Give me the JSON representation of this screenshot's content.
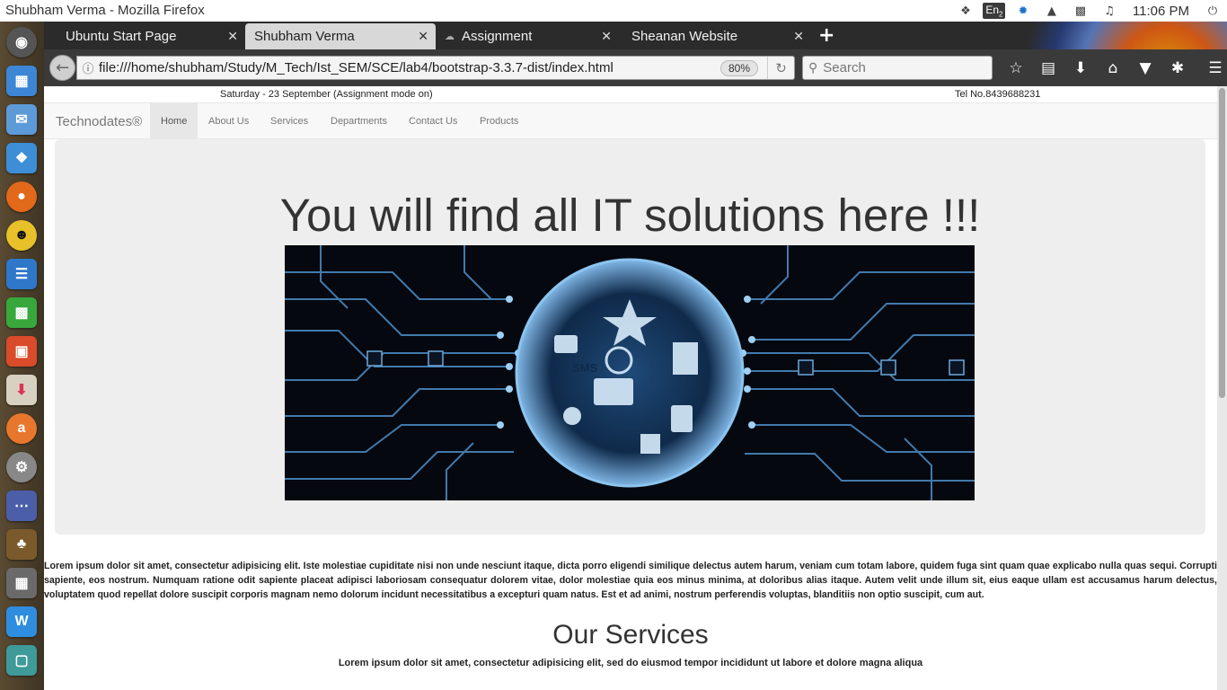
{
  "window": {
    "title": "Shubham Verma - Mozilla Firefox"
  },
  "tray": {
    "lang": "En",
    "lang_sub": "2",
    "clock": "11:06 PM"
  },
  "tabs": [
    {
      "label": "Ubuntu Start Page"
    },
    {
      "label": "Shubham Verma"
    },
    {
      "label": "Assignment"
    },
    {
      "label": "Sheanan Website"
    }
  ],
  "toolbar": {
    "url": "file:///home/shubham/Study/M_Tech/Ist_SEM/SCE/lab4/bootstrap-3.3.7-dist/index.html",
    "zoom": "80%",
    "search_placeholder": "Search"
  },
  "site": {
    "date": "Saturday - 23 September (Assignment mode on)",
    "tel": "Tel No.8439688231",
    "brand": "Technodates®",
    "nav": [
      "Home",
      "About Us",
      "Services",
      "Departments",
      "Contact Us",
      "Products"
    ],
    "headline": "You will find all IT solutions here !!!",
    "hero_text": "SMS",
    "paragraph": "Lorem ipsum dolor sit amet, consectetur adipisicing elit. Iste molestiae cupiditate nisi non unde nesciunt itaque, dicta porro eligendi similique delectus autem harum, veniam cum totam labore, quidem fuga sint quam quae explicabo nulla quas sequi. Corrupti sapiente, eos nostrum. Numquam ratione odit sapiente placeat adipisci laboriosam consequatur dolorem vitae, dolor molestiae quia eos minus minima, at doloribus alias itaque. Autem velit unde illum sit, eius eaque ullam est accusamus harum delectus, voluptatem quod repellat dolore suscipit corporis magnam nemo dolorum incidunt necessitatibus a excepturi quam natus. Est et ad animi, nostrum perferendis voluptas, blanditiis non optio suscipit, cum aut.",
    "services_title": "Our Services",
    "services_sub": "Lorem ipsum dolor sit amet, consectetur adipisicing elit, sed do eiusmod tempor incididunt ut labore et dolore magna aliqua"
  },
  "colors": {
    "tabbar": "#2b2b2b",
    "toolbar": "#3a3a3a",
    "launcher": "#4a3d2a",
    "hero_glow": "#7fb6e6"
  }
}
